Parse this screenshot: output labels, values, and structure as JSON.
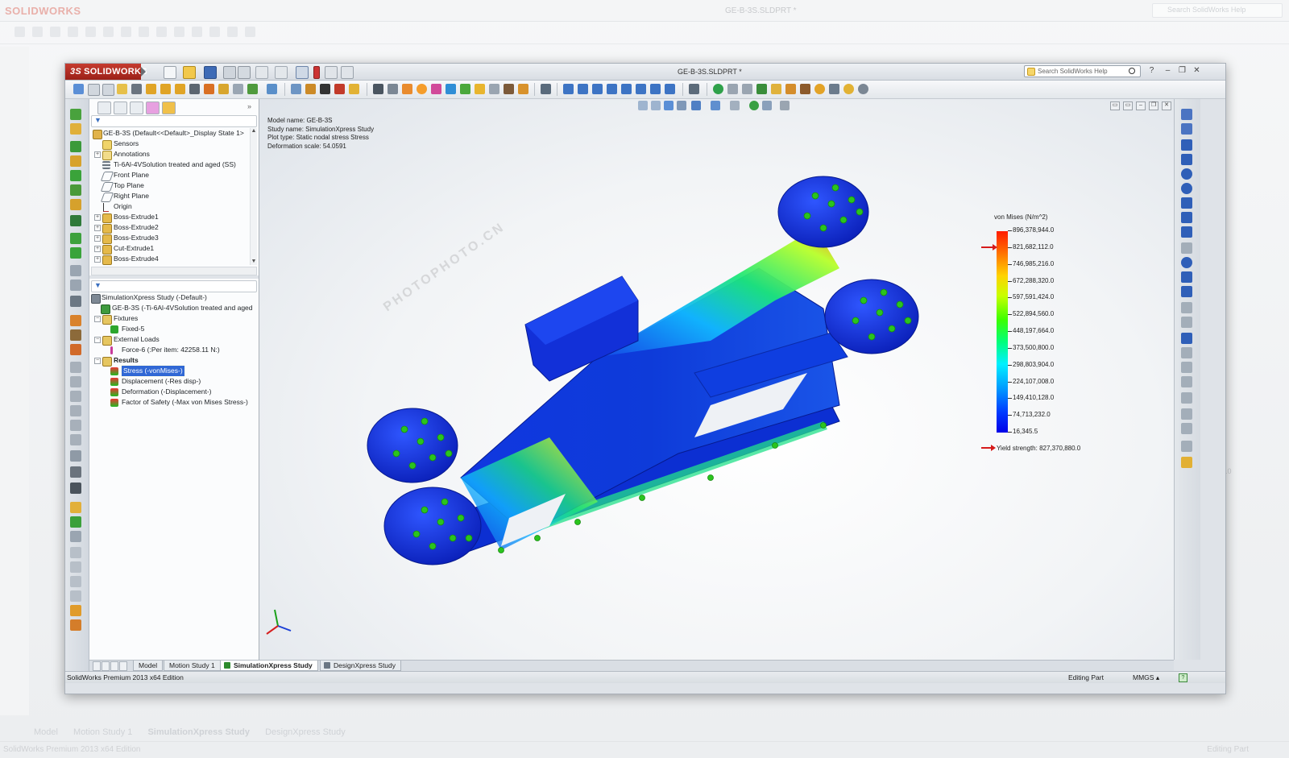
{
  "background": {
    "title": "GE-B-3S.SLDPRT *",
    "search_placeholder": "Search SolidWorks Help",
    "tabs": [
      "Model",
      "Motion Study 1",
      "SimulationXpress Study",
      "DesignXpress Study"
    ],
    "status_left": "SolidWorks Premium 2013 x64 Edition",
    "status_right": "Editing Part",
    "viewport_fragment": "880.0"
  },
  "window": {
    "app_name": "SOLIDWORKS",
    "doc_title": "GE-B-3S.SLDPRT *",
    "search_placeholder": "Search SolidWorks Help"
  },
  "feature_tree": {
    "root": "GE-B-3S  (Default<<Default>_Display State 1>",
    "items": [
      {
        "label": "Sensors",
        "icon": "sensor-icon"
      },
      {
        "label": "Annotations",
        "icon": "annotation-icon"
      },
      {
        "label": "Ti-6Al-4VSolution treated and aged (SS)",
        "icon": "material-icon"
      },
      {
        "label": "Front Plane",
        "icon": "plane-icon"
      },
      {
        "label": "Top Plane",
        "icon": "plane-icon"
      },
      {
        "label": "Right Plane",
        "icon": "plane-icon"
      },
      {
        "label": "Origin",
        "icon": "origin-icon"
      },
      {
        "label": "Boss-Extrude1",
        "icon": "extrude-icon"
      },
      {
        "label": "Boss-Extrude2",
        "icon": "extrude-icon"
      },
      {
        "label": "Boss-Extrude3",
        "icon": "extrude-icon"
      },
      {
        "label": "Cut-Extrude1",
        "icon": "cut-extrude-icon"
      },
      {
        "label": "Boss-Extrude4",
        "icon": "extrude-icon"
      }
    ]
  },
  "sim_tree": {
    "study": "SimulationXpress Study (-Default-)",
    "part": "GE-B-3S (-Ti-6Al-4VSolution treated and aged",
    "fixtures": "Fixtures",
    "fixed": "Fixed-5",
    "external_loads": "External Loads",
    "force": "Force-6 (:Per item: 42258.11 N:)",
    "results": "Results",
    "stress": "Stress (-vonMises-)",
    "displacement": "Displacement (-Res disp-)",
    "deformation": "Deformation (-Displacement-)",
    "fos": "Factor of Safety (-Max von Mises Stress-)"
  },
  "viewport": {
    "model_name": "Model name: GE-B-3S",
    "study_name": "Study name: SimulationXpress Study",
    "plot_type": "Plot type: Static nodal stress Stress",
    "deformation_scale": "Deformation scale: 54.0591"
  },
  "legend": {
    "title": "von Mises (N/m^2)",
    "values": [
      "896,378,944.0",
      "821,682,112.0",
      "746,985,216.0",
      "672,288,320.0",
      "597,591,424.0",
      "522,894,560.0",
      "448,197,664.0",
      "373,500,800.0",
      "298,803,904.0",
      "224,107,008.0",
      "149,410,128.0",
      "74,713,232.0",
      "16,345.5"
    ],
    "yield": "Yield strength: 827,370,880.0",
    "colors": [
      "#ff1c00",
      "#ffd200",
      "#3cff00",
      "#00f0ff",
      "#0039ff",
      "#0000e8"
    ]
  },
  "watermark": {
    "site": "PHOTOPHOTO.CN"
  },
  "tabs": {
    "model": "Model",
    "motion": "Motion Study 1",
    "simulation": "SimulationXpress Study",
    "design": "DesignXpress Study"
  },
  "status": {
    "edition": "SolidWorks Premium 2013 x64 Edition",
    "editing": "Editing Part",
    "units": "MMGS",
    "help": "?"
  },
  "colors": {
    "brand_red": "#c53b2f",
    "selection": "#3168d5",
    "part_blue": "#0a2ed6",
    "fixture_green": "#29c21c",
    "yield_red": "#d61b1b"
  }
}
